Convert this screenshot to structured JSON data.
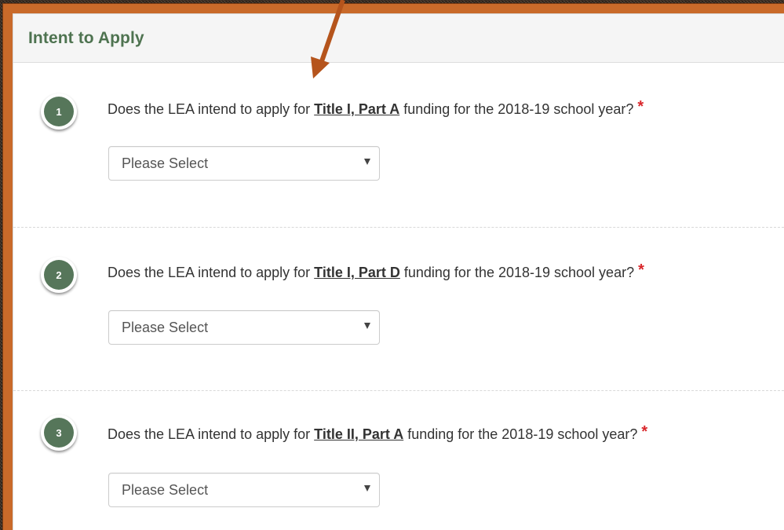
{
  "panel": {
    "title": "Intent to Apply"
  },
  "questions": [
    {
      "number": "1",
      "prefix": "Does the LEA intend to apply for ",
      "program": "Title I, Part A",
      "suffix": " funding for the 2018-19 school year? ",
      "required_mark": "*",
      "select_value": "Please Select"
    },
    {
      "number": "2",
      "prefix": "Does the LEA intend to apply for ",
      "program": "Title I, Part D",
      "suffix": " funding for the 2018-19 school year? ",
      "required_mark": "*",
      "select_value": "Please Select"
    },
    {
      "number": "3",
      "prefix": "Does the LEA intend to apply for ",
      "program": "Title II, Part A",
      "suffix": " funding for the 2018-19 school year? ",
      "required_mark": "*",
      "select_value": "Please Select"
    }
  ],
  "colors": {
    "title_green": "#4e7350",
    "badge_green": "#56765a",
    "required_red": "#d9262a",
    "annotation_arrow": "#b5541c"
  }
}
